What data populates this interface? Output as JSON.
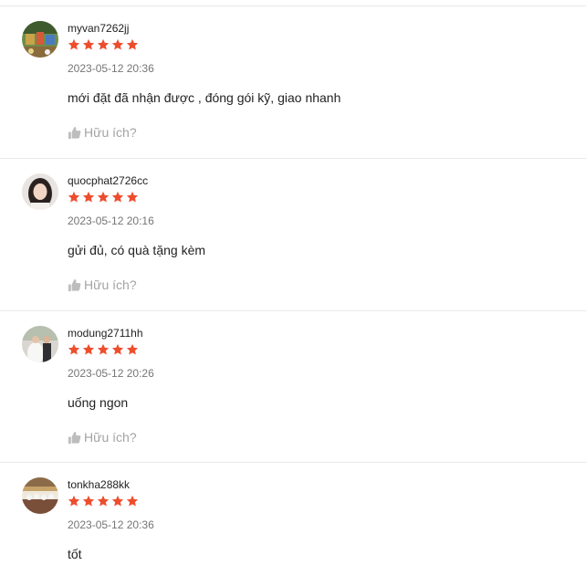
{
  "reviews": [
    {
      "username": "myvan7262jj",
      "rating": 5,
      "timestamp": "2023-05-12 20:36",
      "comment": "mới đặt đã nhận được , đóng gói kỹ, giao nhanh",
      "helpful_label": "Hữu ích?"
    },
    {
      "username": "quocphat2726cc",
      "rating": 5,
      "timestamp": "2023-05-12 20:16",
      "comment": "gửi đủ, có quà tặng kèm",
      "helpful_label": "Hữu ích?"
    },
    {
      "username": "modung2711hh",
      "rating": 5,
      "timestamp": "2023-05-12 20:26",
      "comment": "uống ngon",
      "helpful_label": "Hữu ích?"
    },
    {
      "username": "tonkha288kk",
      "rating": 5,
      "timestamp": "2023-05-12 20:36",
      "comment": "tốt",
      "helpful_label": ""
    }
  ],
  "colors": {
    "star": "#ee4d2d",
    "username": "#222222",
    "timestamp": "#757575",
    "helpful": "#a3a3a3"
  },
  "icons": {
    "star": "star-icon",
    "helpful": "thumbs-up-icon"
  }
}
